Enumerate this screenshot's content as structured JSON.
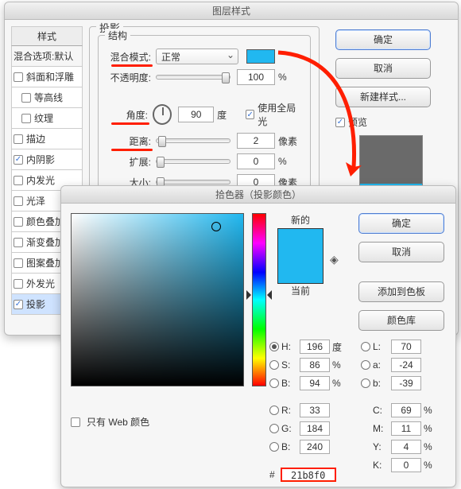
{
  "layerStyle": {
    "title": "图层样式",
    "stylesHeader": "样式",
    "blendDefault": "混合选项:默认",
    "styles": [
      {
        "label": "斜面和浮雕",
        "checked": false
      },
      {
        "label": "等高线",
        "checked": false
      },
      {
        "label": "纹理",
        "checked": false
      },
      {
        "label": "描边",
        "checked": false
      },
      {
        "label": "内阴影",
        "checked": true
      },
      {
        "label": "内发光",
        "checked": false
      },
      {
        "label": "光泽",
        "checked": false
      },
      {
        "label": "颜色叠加",
        "checked": false
      },
      {
        "label": "渐变叠加",
        "checked": false
      },
      {
        "label": "图案叠加",
        "checked": false
      },
      {
        "label": "外发光",
        "checked": false
      },
      {
        "label": "投影",
        "checked": true,
        "selected": true
      }
    ],
    "dropShadow": {
      "legendOuter": "投影",
      "legendInner": "结构",
      "blendModeLabel": "混合模式:",
      "blendModeValue": "正常",
      "swatchColor": "#21b8f0",
      "opacityLabel": "不透明度:",
      "opacityValue": "100",
      "opacityUnit": "%",
      "angleLabel": "角度:",
      "angleValue": "90",
      "angleUnit": "度",
      "globalLightLabel": "使用全局光",
      "distanceLabel": "距离:",
      "distanceValue": "2",
      "distanceUnit": "像素",
      "spreadLabel": "扩展:",
      "spreadValue": "0",
      "spreadUnit": "%",
      "sizeLabel": "大小:",
      "sizeValue": "0",
      "sizeUnit": "像素"
    },
    "buttons": {
      "ok": "确定",
      "cancel": "取消",
      "newStyle": "新建样式...",
      "preview": "预览"
    }
  },
  "colorPicker": {
    "title": "拾色器（投影颜色）",
    "newLabel": "新的",
    "currentLabel": "当前",
    "buttons": {
      "ok": "确定",
      "cancel": "取消",
      "addSwatch": "添加到色板",
      "colorLib": "颜色库"
    },
    "webOnly": "只有 Web 颜色",
    "H": {
      "label": "H:",
      "value": "196",
      "unit": "度"
    },
    "S": {
      "label": "S:",
      "value": "86",
      "unit": "%"
    },
    "Bv": {
      "label": "B:",
      "value": "94",
      "unit": "%"
    },
    "L": {
      "label": "L:",
      "value": "70",
      "unit": ""
    },
    "a": {
      "label": "a:",
      "value": "-24",
      "unit": ""
    },
    "b": {
      "label": "b:",
      "value": "-39",
      "unit": ""
    },
    "R": {
      "label": "R:",
      "value": "33"
    },
    "G": {
      "label": "G:",
      "value": "184"
    },
    "Bc": {
      "label": "B:",
      "value": "240"
    },
    "C": {
      "label": "C:",
      "value": "69",
      "unit": "%"
    },
    "M": {
      "label": "M:",
      "value": "11",
      "unit": "%"
    },
    "Y": {
      "label": "Y:",
      "value": "4",
      "unit": "%"
    },
    "K": {
      "label": "K:",
      "value": "0",
      "unit": "%"
    },
    "hexLabel": "#",
    "hexValue": "21b8f0"
  },
  "chart_data": null
}
